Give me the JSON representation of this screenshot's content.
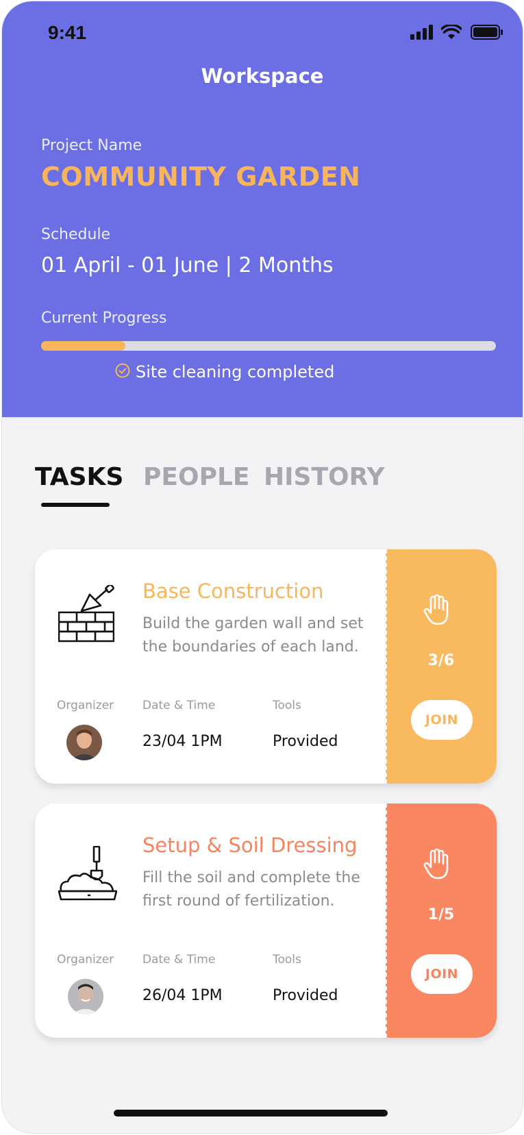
{
  "status_bar": {
    "time": "9:41",
    "icons": [
      "signal-icon",
      "wifi-icon",
      "battery-icon"
    ]
  },
  "header": {
    "title": "Workspace",
    "project_label": "Project Name",
    "project_name": "COMMUNITY GARDEN",
    "schedule_label": "Schedule",
    "schedule_value": "01 April - 01 June | 2 Months",
    "progress_label": "Current Progress",
    "progress_fraction": 0.185,
    "progress_note": "Site cleaning completed"
  },
  "tabs": [
    {
      "label": "TASKS",
      "active": true
    },
    {
      "label": "PEOPLE",
      "active": false
    },
    {
      "label": "HISTORY",
      "active": false
    }
  ],
  "tasks": [
    {
      "title": "Base Construction",
      "description": "Build the garden wall and set the boundaries of each land.",
      "icon": "brick-wall-trowel-icon",
      "organizer_label": "Organizer",
      "datetime_label": "Date & Time",
      "tools_label": "Tools",
      "datetime": "23/04 1PM",
      "tools": "Provided",
      "count": "3/6",
      "join_label": "JOIN",
      "accent": "#f8b55c",
      "side_color": "#f8b95f"
    },
    {
      "title": "Setup & Soil Dressing",
      "description": "Fill the soil and complete the first round of fertilization.",
      "icon": "soil-shovel-icon",
      "organizer_label": "Organizer",
      "datetime_label": "Date & Time",
      "tools_label": "Tools",
      "datetime": "26/04 1PM",
      "tools": "Provided",
      "count": "1/5",
      "join_label": "JOIN",
      "accent": "#f6845f",
      "side_color": "#f98762"
    }
  ],
  "colors": {
    "header_bg": "#6b6fe3",
    "accent_orange": "#f8b55c",
    "screen_bg": "#f3f3f5"
  }
}
